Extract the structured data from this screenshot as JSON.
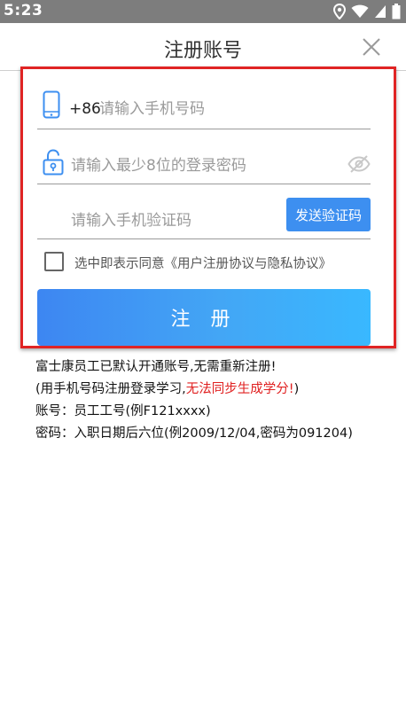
{
  "status_bar": {
    "time": "5:23"
  },
  "header": {
    "title": "注册账号"
  },
  "form": {
    "phone": {
      "country_code": "+86",
      "placeholder": "请输入手机号码"
    },
    "password": {
      "placeholder": "请输入最少8位的登录密码"
    },
    "code": {
      "placeholder": "请输入手机验证码",
      "send_label": "发送验证码"
    },
    "agreement": {
      "label": "选中即表示同意《用户注册协议与隐私协议》",
      "checked": false
    },
    "submit_label": "注 册"
  },
  "notes": {
    "line1": "富士康员工已默认开通账号,无需重新注册!",
    "line2_pre": "(用手机号码注册登录学习,",
    "line2_warning": "无法同步生成学分!",
    "line2_post": ")",
    "line3": "账号：员工工号(例F121xxxx)",
    "line4": "密码：入职日期后六位(例2009/12/04,密码为091204)"
  },
  "colors": {
    "accent": "#3d8ff0",
    "highlight_border": "#e02424",
    "warning_text": "#e02020",
    "status_bar": "#7d7d7d"
  }
}
